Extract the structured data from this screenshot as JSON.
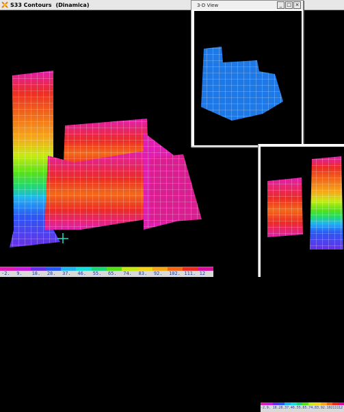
{
  "main_window": {
    "title": "S33 Contours",
    "mode": "(Dinamica)"
  },
  "legend": {
    "values": [
      "-2.",
      "9.",
      "18.",
      "28.",
      "37.",
      "46.",
      "55.",
      "65.",
      "74.",
      "83.",
      "92.",
      "102.",
      "111.",
      "12"
    ],
    "colors": [
      "#e01fb0",
      "#c81ee0",
      "#6a2fe8",
      "#2a58f5",
      "#21b4f0",
      "#18e0d8",
      "#1ed67a",
      "#55e11a",
      "#c7ea16",
      "#f1d51a",
      "#f5a81a",
      "#f26a19",
      "#ec2b25",
      "#d90f9a"
    ]
  },
  "view3d_window": {
    "title": "3-D View",
    "minimize_label": "_",
    "maximize_label": "□",
    "close_label": "×"
  },
  "right_window": {
    "legend_values": [
      "-2.",
      "9.",
      "18.",
      "28.",
      "37.",
      "46.",
      "55.",
      "65.",
      "74.",
      "83.",
      "92.",
      "102.",
      "111.",
      "12"
    ]
  }
}
